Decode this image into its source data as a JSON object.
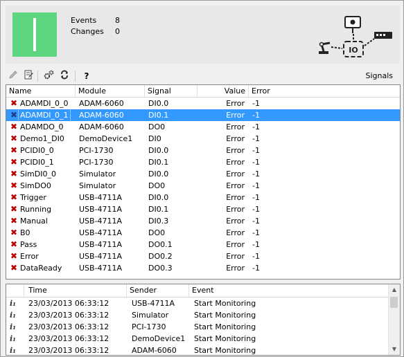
{
  "status": {
    "color": "#5ed680"
  },
  "stats": {
    "events_label": "Events",
    "events_value": "8",
    "changes_label": "Changes",
    "changes_value": "0"
  },
  "io_graphic": {
    "text": "IO"
  },
  "toolbar": {
    "title": "Signals",
    "help_label": "?",
    "buttons": [
      "pencil-icon",
      "edit-document-icon",
      "settings-gears-icon",
      "refresh-icon",
      "help-icon"
    ]
  },
  "signals": {
    "columns": [
      "Name",
      "Module",
      "Signal",
      "Value",
      "Error"
    ],
    "rows": [
      {
        "name": "ADAMDI_0_0",
        "module": "ADAM-6060",
        "signal": "DI0.0",
        "value": "Error",
        "error": "-1"
      },
      {
        "name": "ADAMDI_0_1",
        "module": "ADAM-6060",
        "signal": "DI0.1",
        "value": "Error",
        "error": "-1"
      },
      {
        "name": "ADAMDO_0",
        "module": "ADAM-6060",
        "signal": "DO0",
        "value": "Error",
        "error": "-1"
      },
      {
        "name": "Demo1_DI0",
        "module": "DemoDevice1",
        "signal": "DI0",
        "value": "Error",
        "error": "-1"
      },
      {
        "name": "PCIDI0_0",
        "module": "PCI-1730",
        "signal": "DI0.0",
        "value": "Error",
        "error": "-1"
      },
      {
        "name": "PCIDI0_1",
        "module": "PCI-1730",
        "signal": "DI0.1",
        "value": "Error",
        "error": "-1"
      },
      {
        "name": "SimDI0_0",
        "module": "Simulator",
        "signal": "DI0.0",
        "value": "Error",
        "error": "-1"
      },
      {
        "name": "SimDO0",
        "module": "Simulator",
        "signal": "DO0",
        "value": "Error",
        "error": "-1"
      },
      {
        "name": "Trigger",
        "module": "USB-4711A",
        "signal": "DI0.0",
        "value": "Error",
        "error": "-1"
      },
      {
        "name": "Running",
        "module": "USB-4711A",
        "signal": "DI0.1",
        "value": "Error",
        "error": "-1"
      },
      {
        "name": "Manual",
        "module": "USB-4711A",
        "signal": "DI0.3",
        "value": "Error",
        "error": "-1"
      },
      {
        "name": "B0",
        "module": "USB-4711A",
        "signal": "DO0",
        "value": "Error",
        "error": "-1"
      },
      {
        "name": "Pass",
        "module": "USB-4711A",
        "signal": "DO0.1",
        "value": "Error",
        "error": "-1"
      },
      {
        "name": "Error",
        "module": "USB-4711A",
        "signal": "DO0.2",
        "value": "Error",
        "error": "-1"
      },
      {
        "name": "DataReady",
        "module": "USB-4711A",
        "signal": "DO0.3",
        "value": "Error",
        "error": "-1"
      }
    ],
    "selected_index": 1
  },
  "log": {
    "columns": [
      "Time",
      "Sender",
      "Event"
    ],
    "rows": [
      {
        "time": "23/03/2013 06:33:12",
        "sender": "USB-4711A",
        "event": "Start Monitoring"
      },
      {
        "time": "23/03/2013 06:33:12",
        "sender": "Simulator",
        "event": "Start Monitoring"
      },
      {
        "time": "23/03/2013 06:33:12",
        "sender": "PCI-1730",
        "event": "Start Monitoring"
      },
      {
        "time": "23/03/2013 06:33:12",
        "sender": "DemoDevice1",
        "event": "Start Monitoring"
      },
      {
        "time": "23/03/2013 06:33:12",
        "sender": "ADAM-6060",
        "event": "Start Monitoring"
      }
    ]
  }
}
